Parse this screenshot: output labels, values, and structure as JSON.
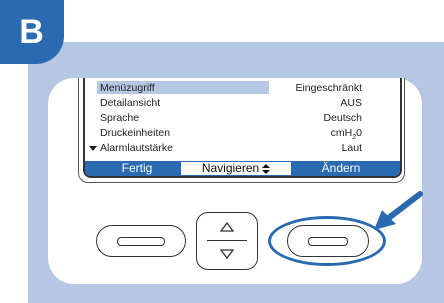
{
  "badge": {
    "letter": "B"
  },
  "colors": {
    "accent": "#2a6ab1",
    "panel": "#b5c7e3"
  },
  "menu": {
    "rows": [
      {
        "label": "Menüzugriff",
        "value": "Eingeschränkt",
        "highlighted": true
      },
      {
        "label": "Detailansicht",
        "value": "AUS"
      },
      {
        "label": "Sprache",
        "value": "Deutsch"
      },
      {
        "label": "Druckeinheiten",
        "value": "cmH",
        "value_sub": "2",
        "value_suffix": "0"
      },
      {
        "label": "Alarmlautstärke",
        "value": "Laut",
        "scroll_indicator": "down-arrow"
      }
    ]
  },
  "softkeys": {
    "left": "Fertig",
    "center": "Navigieren",
    "center_icon": "up-down-arrows-icon",
    "right": "Ändern"
  },
  "hardware_buttons": {
    "left": "left-softkey-button",
    "middle": "navigate-up-down-button",
    "right": "right-softkey-button",
    "highlighted": "right"
  }
}
